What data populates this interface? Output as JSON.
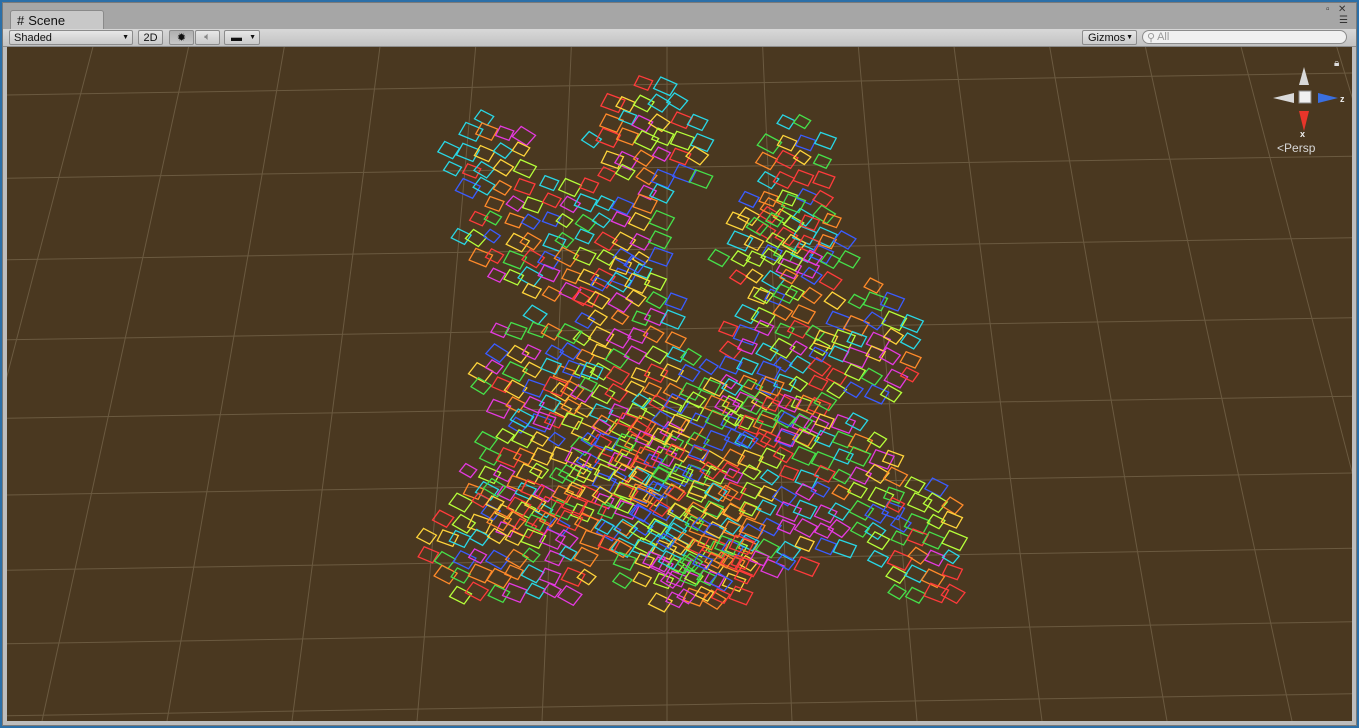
{
  "window": {
    "tab_title": "Scene",
    "tab_icon": "scene-grid-icon"
  },
  "toolbar": {
    "draw_mode": "Shaded",
    "mode_2d_label": "2D",
    "lighting_icon": "sun-icon",
    "audio_icon": "speaker-icon",
    "effects_icon": "image-icon",
    "gizmos_label": "Gizmos",
    "search_placeholder": "All"
  },
  "viewport": {
    "background_color": "#4a3820",
    "grid_color": "#6b5a40",
    "projection_label": "Persp",
    "gizmo_axis_x": "x",
    "gizmo_axis_z": "z",
    "gizmo_colors": {
      "x": "#e8352a",
      "y": "#d9d9d9",
      "z": "#3a6fe0"
    },
    "wire_palette": [
      "#ff3b3b",
      "#ffd43b",
      "#46e04a",
      "#29d7e6",
      "#3a5cff",
      "#e43ae0",
      "#ff8a2a",
      "#b6ff3a"
    ]
  }
}
